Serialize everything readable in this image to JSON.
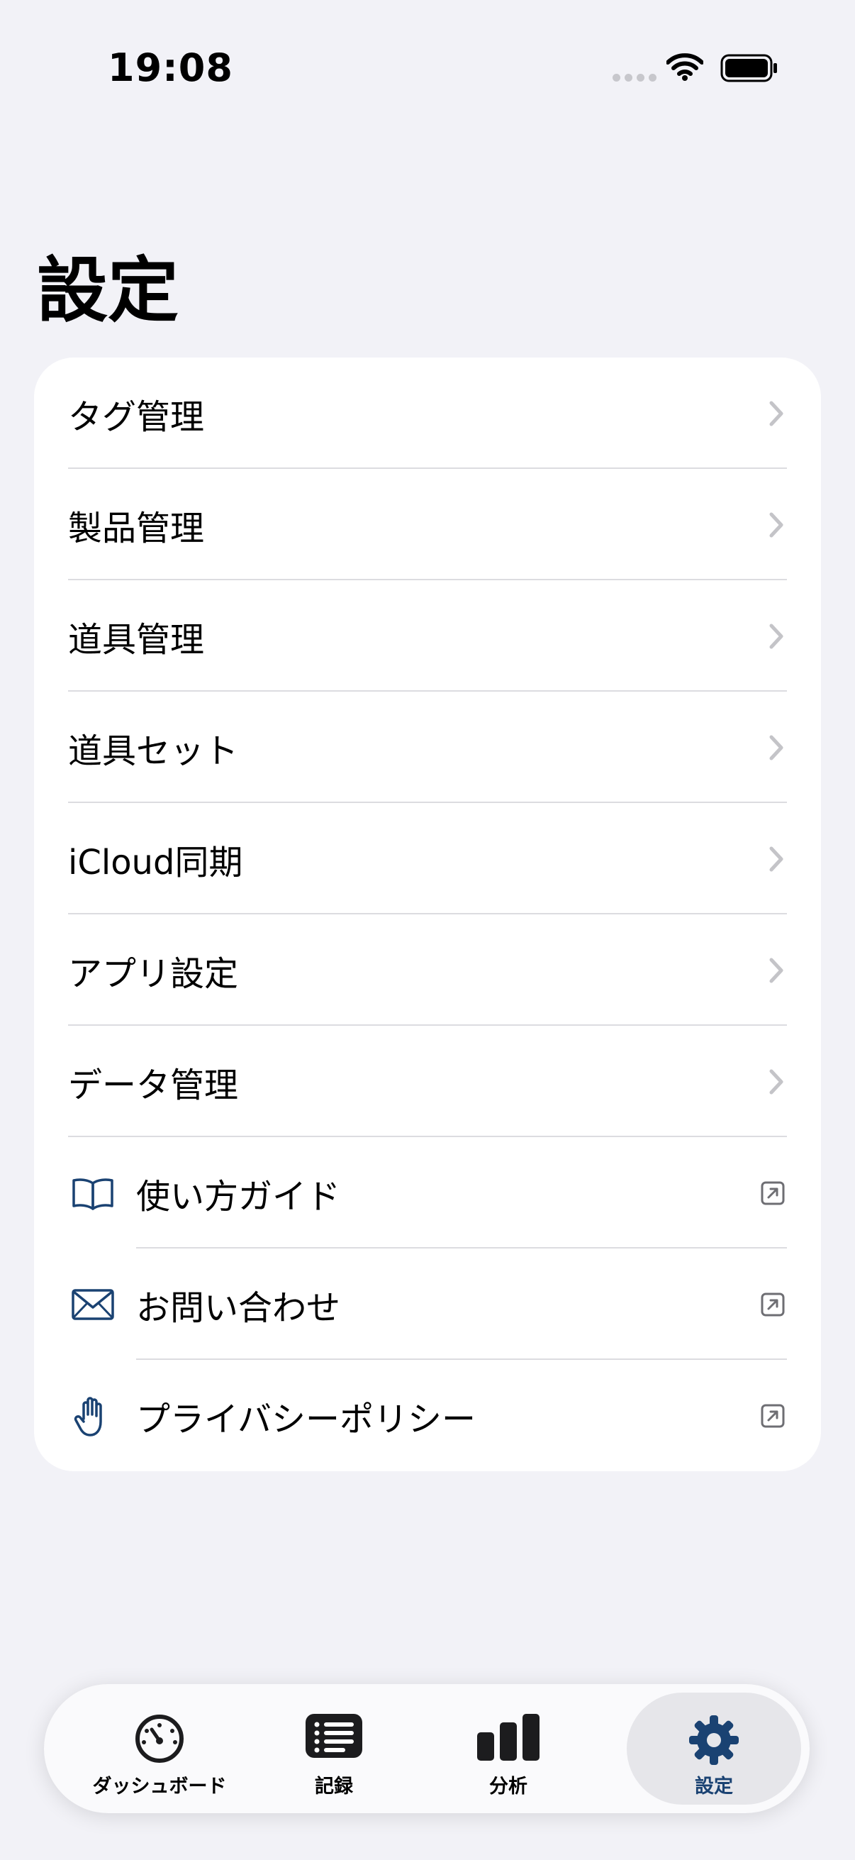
{
  "status_bar": {
    "time": "19:08"
  },
  "page_title": "設定",
  "menu": {
    "items": [
      {
        "label": "タグ管理"
      },
      {
        "label": "製品管理"
      },
      {
        "label": "道具管理"
      },
      {
        "label": "道具セット"
      },
      {
        "label": "iCloud同期"
      },
      {
        "label": "アプリ設定"
      },
      {
        "label": "データ管理"
      }
    ],
    "links": [
      {
        "label": "使い方ガイド",
        "icon": "book-icon"
      },
      {
        "label": "お問い合わせ",
        "icon": "envelope-icon"
      },
      {
        "label": "プライバシーポリシー",
        "icon": "hand-icon"
      }
    ]
  },
  "tabbar": {
    "tabs": [
      {
        "label": "ダッシュボード",
        "icon": "gauge-icon"
      },
      {
        "label": "記録",
        "icon": "list-icon"
      },
      {
        "label": "分析",
        "icon": "bar-chart-icon"
      },
      {
        "label": "設定",
        "icon": "gear-icon"
      }
    ],
    "active_color": "#1a4272"
  }
}
